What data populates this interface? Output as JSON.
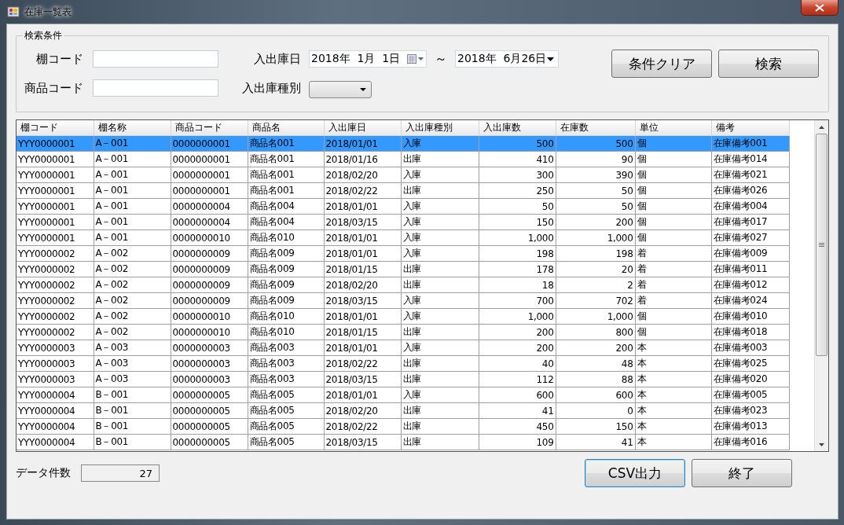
{
  "window": {
    "title": "在庫一覧表"
  },
  "search": {
    "title": "検索条件",
    "shelf_code": {
      "label": "棚コード"
    },
    "product_code": {
      "label": "商品コード"
    },
    "date": {
      "label": "入出庫日",
      "from": "2018年  1月  1日",
      "separator": "～",
      "to": "2018年  6月26日"
    },
    "type": {
      "label": "入出庫種別"
    },
    "buttons": [
      {
        "label": "条件クリア",
        "focused": false
      },
      {
        "label": "検索",
        "focused": false
      }
    ]
  },
  "table": {
    "columns": [
      "棚コード",
      "棚名称",
      "商品コード",
      "商品名",
      "入出庫日",
      "入出庫種別",
      "入出庫数",
      "在庫数",
      "単位",
      "備考"
    ],
    "rows": [
      {
        "selected": true,
        "cells": [
          "YYY0000001",
          "A－001",
          "0000000001",
          "商品名001",
          "2018/01/01",
          "入庫",
          "500",
          "500",
          "個",
          "在庫備考001"
        ]
      },
      {
        "selected": false,
        "cells": [
          "YYY0000001",
          "A－001",
          "0000000001",
          "商品名001",
          "2018/01/16",
          "出庫",
          "410",
          "90",
          "個",
          "在庫備考014"
        ]
      },
      {
        "selected": false,
        "cells": [
          "YYY0000001",
          "A－001",
          "0000000001",
          "商品名001",
          "2018/02/20",
          "入庫",
          "300",
          "390",
          "個",
          "在庫備考021"
        ]
      },
      {
        "selected": false,
        "cells": [
          "YYY0000001",
          "A－001",
          "0000000001",
          "商品名001",
          "2018/02/22",
          "出庫",
          "250",
          "50",
          "個",
          "在庫備考026"
        ]
      },
      {
        "selected": false,
        "cells": [
          "YYY0000001",
          "A－001",
          "0000000004",
          "商品名004",
          "2018/01/01",
          "入庫",
          "50",
          "50",
          "個",
          "在庫備考004"
        ]
      },
      {
        "selected": false,
        "cells": [
          "YYY0000001",
          "A－001",
          "0000000004",
          "商品名004",
          "2018/03/15",
          "入庫",
          "150",
          "200",
          "個",
          "在庫備考017"
        ]
      },
      {
        "selected": false,
        "cells": [
          "YYY0000001",
          "A－001",
          "0000000010",
          "商品名010",
          "2018/01/01",
          "入庫",
          "1,000",
          "1,000",
          "個",
          "在庫備考027"
        ]
      },
      {
        "selected": false,
        "cells": [
          "YYY0000002",
          "A－002",
          "0000000009",
          "商品名009",
          "2018/01/01",
          "入庫",
          "198",
          "198",
          "着",
          "在庫備考009"
        ]
      },
      {
        "selected": false,
        "cells": [
          "YYY0000002",
          "A－002",
          "0000000009",
          "商品名009",
          "2018/01/15",
          "出庫",
          "178",
          "20",
          "着",
          "在庫備考011"
        ]
      },
      {
        "selected": false,
        "cells": [
          "YYY0000002",
          "A－002",
          "0000000009",
          "商品名009",
          "2018/02/20",
          "出庫",
          "18",
          "2",
          "着",
          "在庫備考012"
        ]
      },
      {
        "selected": false,
        "cells": [
          "YYY0000002",
          "A－002",
          "0000000009",
          "商品名009",
          "2018/03/15",
          "入庫",
          "700",
          "702",
          "着",
          "在庫備考024"
        ]
      },
      {
        "selected": false,
        "cells": [
          "YYY0000002",
          "A－002",
          "0000000010",
          "商品名010",
          "2018/01/01",
          "入庫",
          "1,000",
          "1,000",
          "個",
          "在庫備考010"
        ]
      },
      {
        "selected": false,
        "cells": [
          "YYY0000002",
          "A－002",
          "0000000010",
          "商品名010",
          "2018/01/15",
          "出庫",
          "200",
          "800",
          "個",
          "在庫備考018"
        ]
      },
      {
        "selected": false,
        "cells": [
          "YYY0000003",
          "A－003",
          "0000000003",
          "商品名003",
          "2018/01/01",
          "入庫",
          "200",
          "200",
          "本",
          "在庫備考003"
        ]
      },
      {
        "selected": false,
        "cells": [
          "YYY0000003",
          "A－003",
          "0000000003",
          "商品名003",
          "2018/02/22",
          "出庫",
          "40",
          "48",
          "本",
          "在庫備考025"
        ]
      },
      {
        "selected": false,
        "cells": [
          "YYY0000003",
          "A－003",
          "0000000003",
          "商品名003",
          "2018/03/15",
          "出庫",
          "112",
          "88",
          "本",
          "在庫備考020"
        ]
      },
      {
        "selected": false,
        "cells": [
          "YYY0000004",
          "B－001",
          "0000000005",
          "商品名005",
          "2018/01/01",
          "入庫",
          "600",
          "600",
          "本",
          "在庫備考005"
        ]
      },
      {
        "selected": false,
        "cells": [
          "YYY0000004",
          "B－001",
          "0000000005",
          "商品名005",
          "2018/02/20",
          "出庫",
          "41",
          "0",
          "本",
          "在庫備考023"
        ]
      },
      {
        "selected": false,
        "cells": [
          "YYY0000004",
          "B－001",
          "0000000005",
          "商品名005",
          "2018/02/22",
          "出庫",
          "450",
          "150",
          "本",
          "在庫備考013"
        ]
      },
      {
        "selected": false,
        "cells": [
          "YYY0000004",
          "B－001",
          "0000000005",
          "商品名005",
          "2018/03/15",
          "出庫",
          "109",
          "41",
          "本",
          "在庫備考016"
        ]
      }
    ]
  },
  "footer": {
    "count_label": "データ件数",
    "count": "27",
    "buttons": [
      {
        "label": "CSV出力",
        "focused": true
      },
      {
        "label": "終了",
        "focused": false
      }
    ]
  }
}
